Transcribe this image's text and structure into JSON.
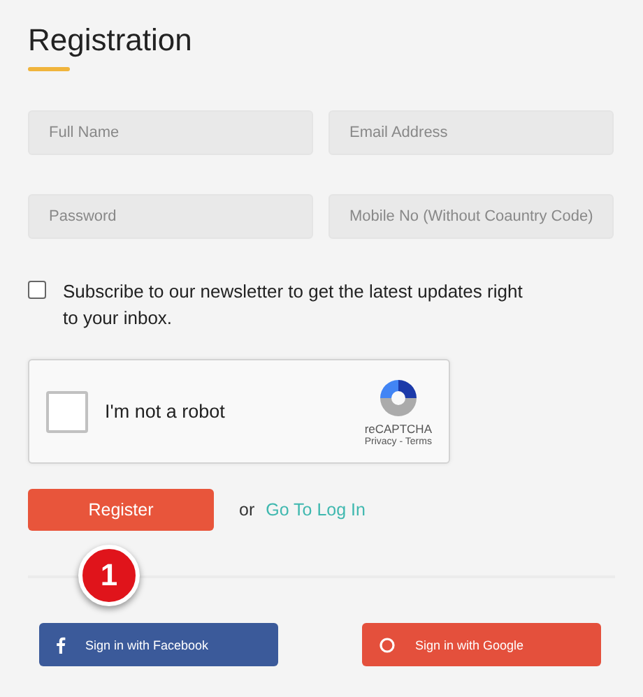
{
  "title": "Registration",
  "fields": [
    {
      "placeholder": "Full Name"
    },
    {
      "placeholder": "Email Address"
    },
    {
      "placeholder": "Password"
    },
    {
      "placeholder": "Mobile No (Without Coauntry Code)"
    }
  ],
  "newsletter": {
    "label": "Subscribe to our newsletter to get the latest updates right to your inbox.",
    "checked": false
  },
  "captcha": {
    "label": "I'm not a robot",
    "checked": false,
    "brand": "reCAPTCHA",
    "links": "Privacy - Terms"
  },
  "register_button": "Register",
  "or_text": "or",
  "login_link": "Go To Log In",
  "callout_badge": "1",
  "social_buttons": [
    {
      "kind": "facebook",
      "label": "Sign in with Facebook"
    },
    {
      "kind": "google",
      "label": "Sign in with Google"
    }
  ]
}
